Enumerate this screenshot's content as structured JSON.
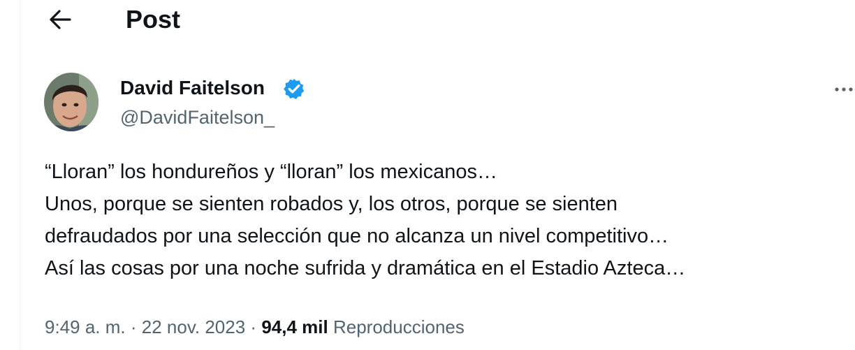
{
  "header": {
    "title": "Post",
    "back_icon": "arrow-left-icon"
  },
  "author": {
    "name": "David Faitelson",
    "handle": "@DavidFaitelson_",
    "verified": true,
    "verified_color": "#1d9bf0",
    "avatar_icon": "avatar-photo"
  },
  "more_icon": "more-horizontal-icon",
  "tweet": {
    "lines": [
      "“Lloran” los hondureños y “lloran” los mexicanos…",
      "Unos, porque se sienten robados y, los otros, porque se sienten",
      "defraudados por una selección que no alcanza un nivel competitivo…",
      "Así las cosas por una noche sufrida y dramática en el Estadio Azteca…"
    ]
  },
  "meta": {
    "time": "9:49 a. m.",
    "separator": "·",
    "date": "22 nov. 2023",
    "views_count": "94,4 mil",
    "views_label": "Reproducciones"
  },
  "colors": {
    "text_primary": "#0f1419",
    "text_secondary": "#536471",
    "border": "#eff3f4"
  }
}
